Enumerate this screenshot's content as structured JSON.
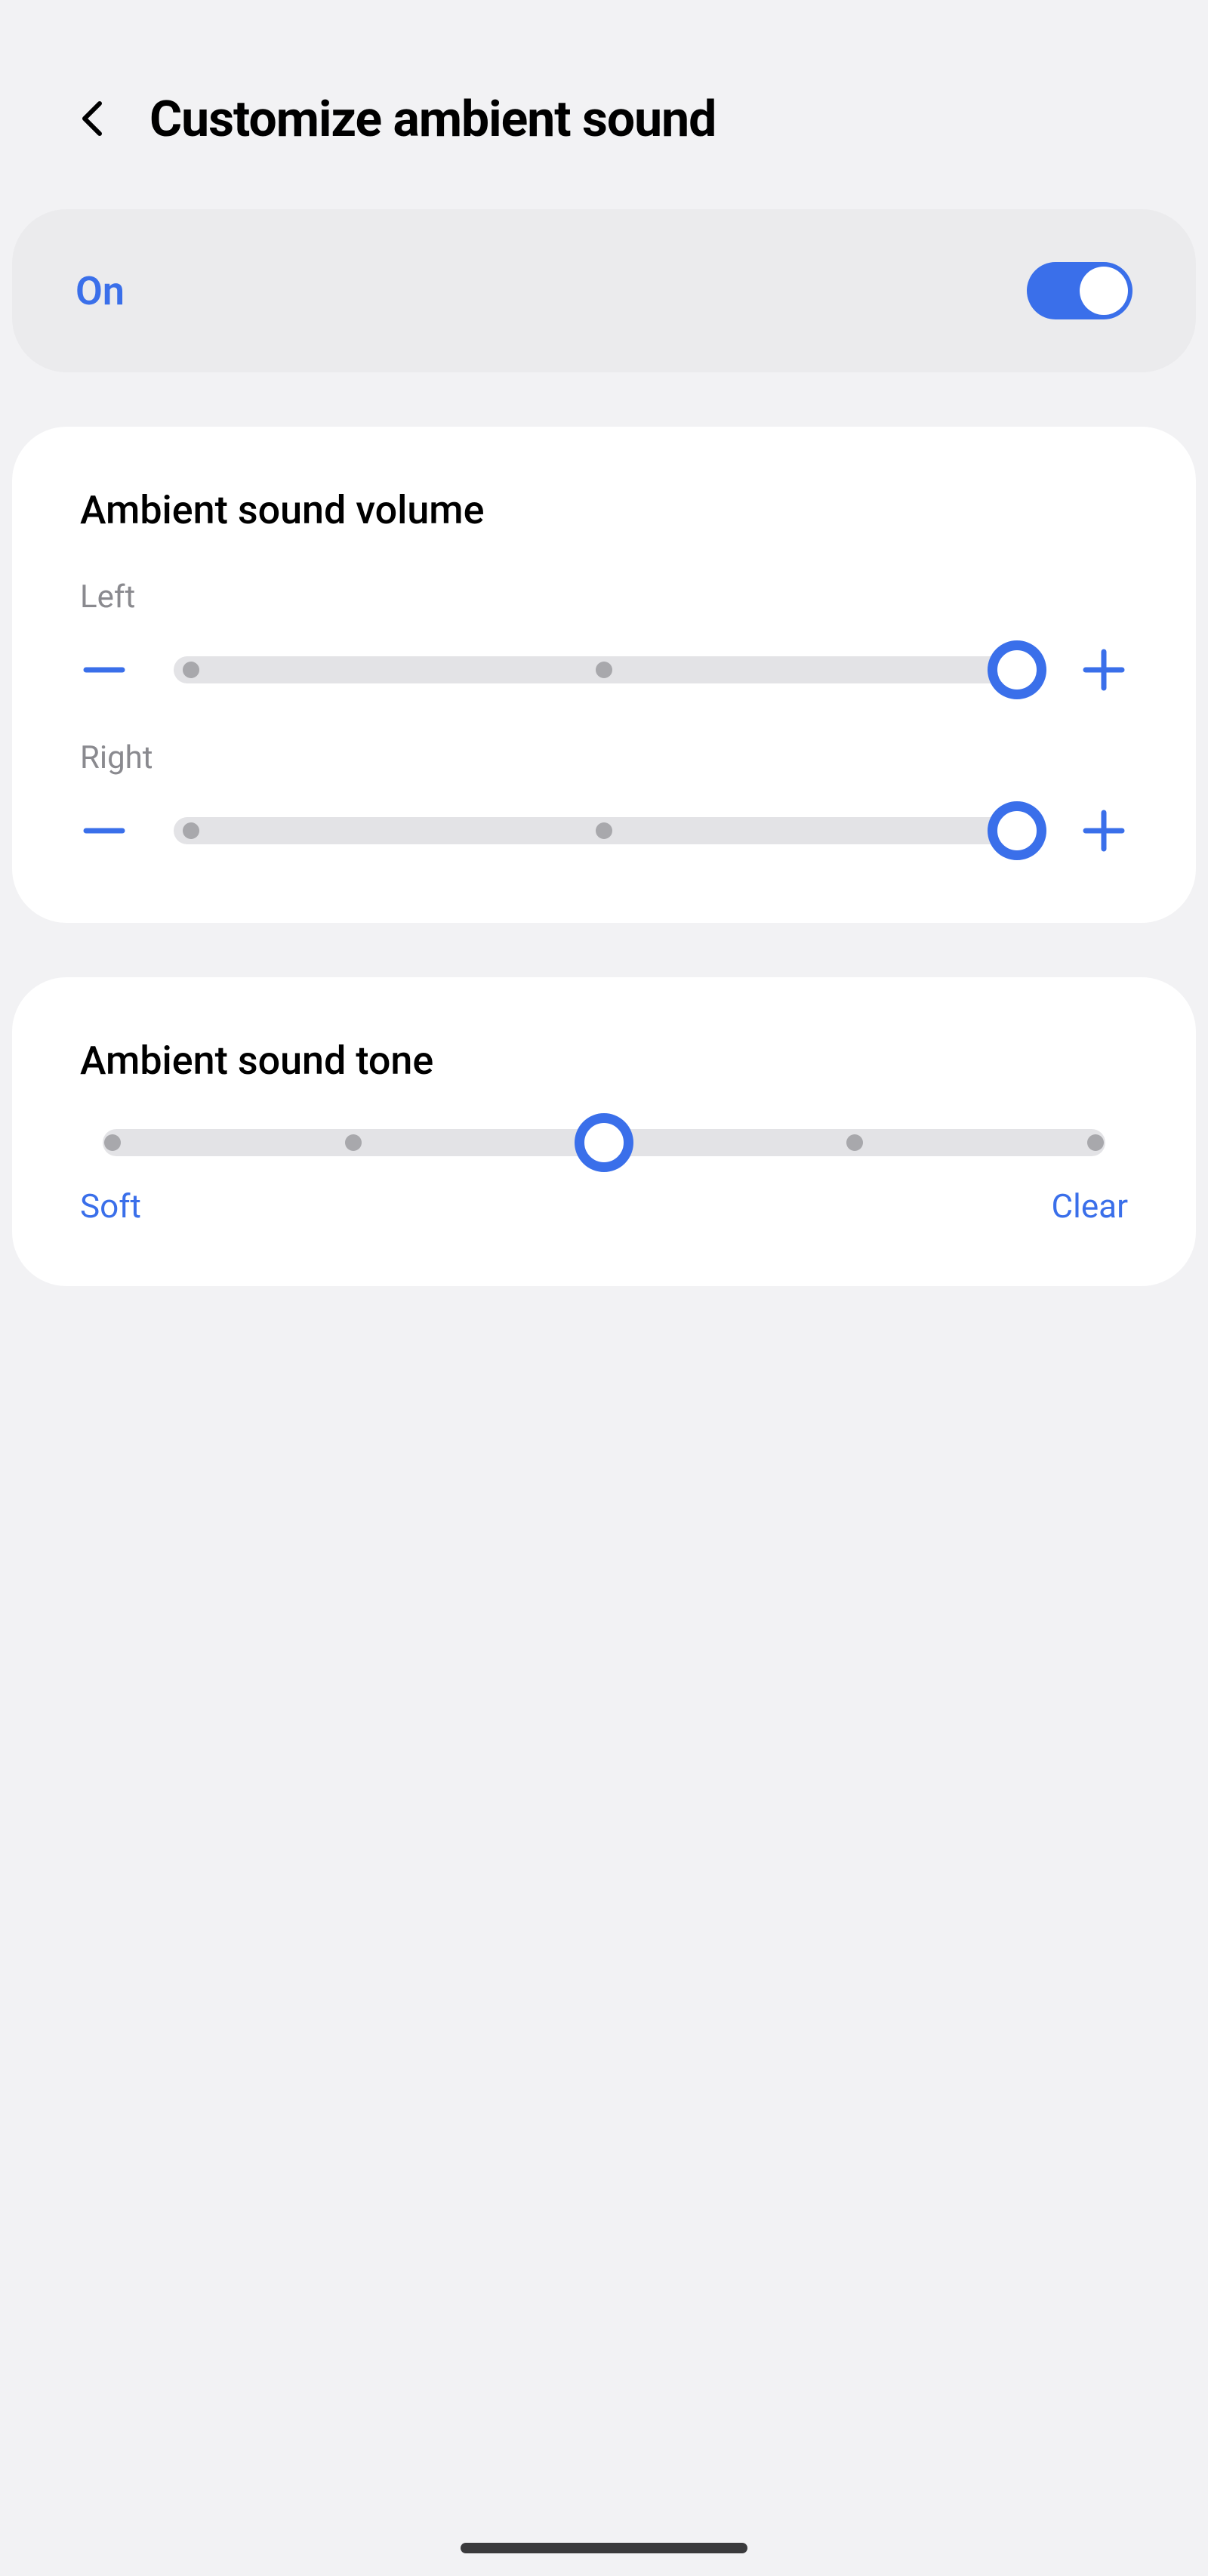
{
  "header": {
    "title": "Customize ambient sound"
  },
  "toggle": {
    "label": "On",
    "state": true
  },
  "volume_card": {
    "title": "Ambient sound volume",
    "sliders": [
      {
        "label": "Left",
        "value": 2,
        "max": 2
      },
      {
        "label": "Right",
        "value": 2,
        "max": 2
      }
    ]
  },
  "tone_card": {
    "title": "Ambient sound tone",
    "value": 2,
    "max": 4,
    "left_label": "Soft",
    "right_label": "Clear"
  },
  "colors": {
    "accent": "#3a6fea"
  }
}
